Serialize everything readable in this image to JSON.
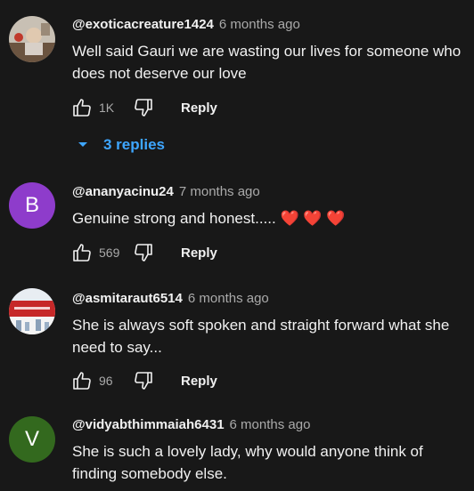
{
  "colors": {
    "background": "#181818",
    "text": "#f1f1f1",
    "muted": "#aaaaaa",
    "link": "#3ea6ff",
    "avatar_b": "#8e3ccb",
    "avatar_v": "#33691e"
  },
  "comments": [
    {
      "author": "@exoticacreature1424",
      "time": "6 months ago",
      "text": "Well said Gauri we are wasting our lives for someone who does not deserve our love",
      "likes": "1K",
      "reply_label": "Reply",
      "replies_label": "3 replies",
      "avatar_icon": "photo-avatar-icon"
    },
    {
      "author": "@ananyacinu24",
      "time": "7 months ago",
      "text": "Genuine strong and honest.....",
      "emoji": "❤️ ❤️ ❤️",
      "likes": "569",
      "reply_label": "Reply",
      "avatar_letter": "B"
    },
    {
      "author": "@asmitaraut6514",
      "time": "6 months ago",
      "text": "She is always soft spoken and straight forward what she need to say...",
      "likes": "96",
      "reply_label": "Reply",
      "avatar_icon": "photo-avatar-icon"
    },
    {
      "author": "@vidyabthimmaiah6431",
      "time": "6 months ago",
      "text": "She is such a lovely lady, why would anyone think of finding somebody else.",
      "avatar_letter": "V"
    }
  ]
}
